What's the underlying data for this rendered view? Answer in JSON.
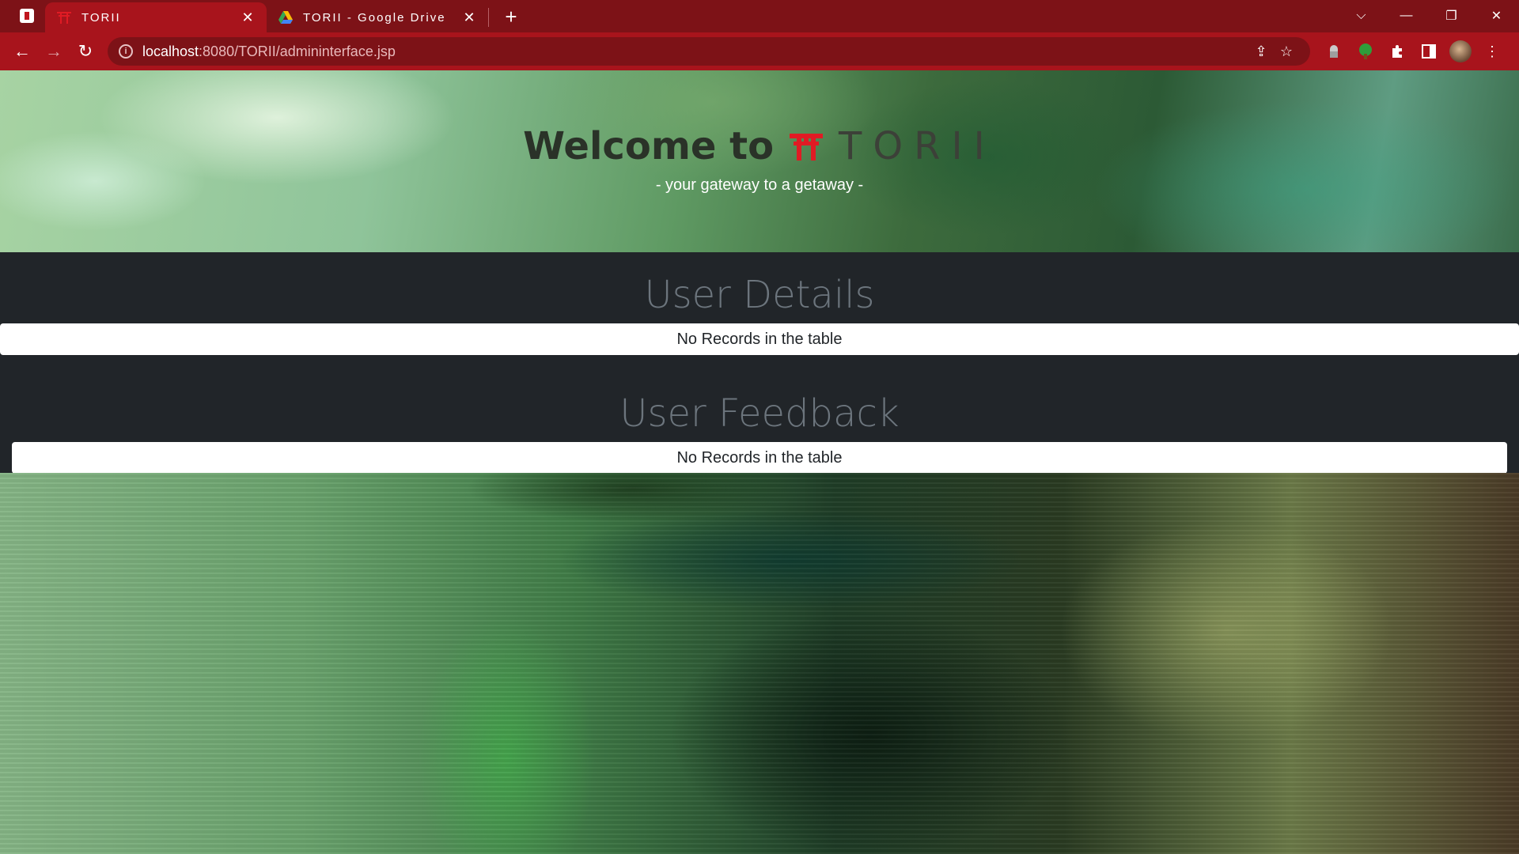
{
  "browser": {
    "tabs": [
      {
        "title": "TORII",
        "active": true
      },
      {
        "title": "TORII - Google Drive",
        "active": false
      }
    ],
    "url_host": "localhost",
    "url_path": ":8080/TORII/admininterface.jsp"
  },
  "header": {
    "welcome": "Welcome to",
    "brand": "TORII",
    "tagline": "- your gateway to a getaway -"
  },
  "sections": {
    "user_details": {
      "title": "User Details",
      "empty_message": "No Records in the table"
    },
    "user_feedback": {
      "title": "User Feedback",
      "empty_message": "No Records in the table"
    }
  },
  "colors": {
    "chrome_dark": "#7d1217",
    "chrome": "#a8141c",
    "band": "#212529",
    "torii_red": "#e01b24"
  }
}
